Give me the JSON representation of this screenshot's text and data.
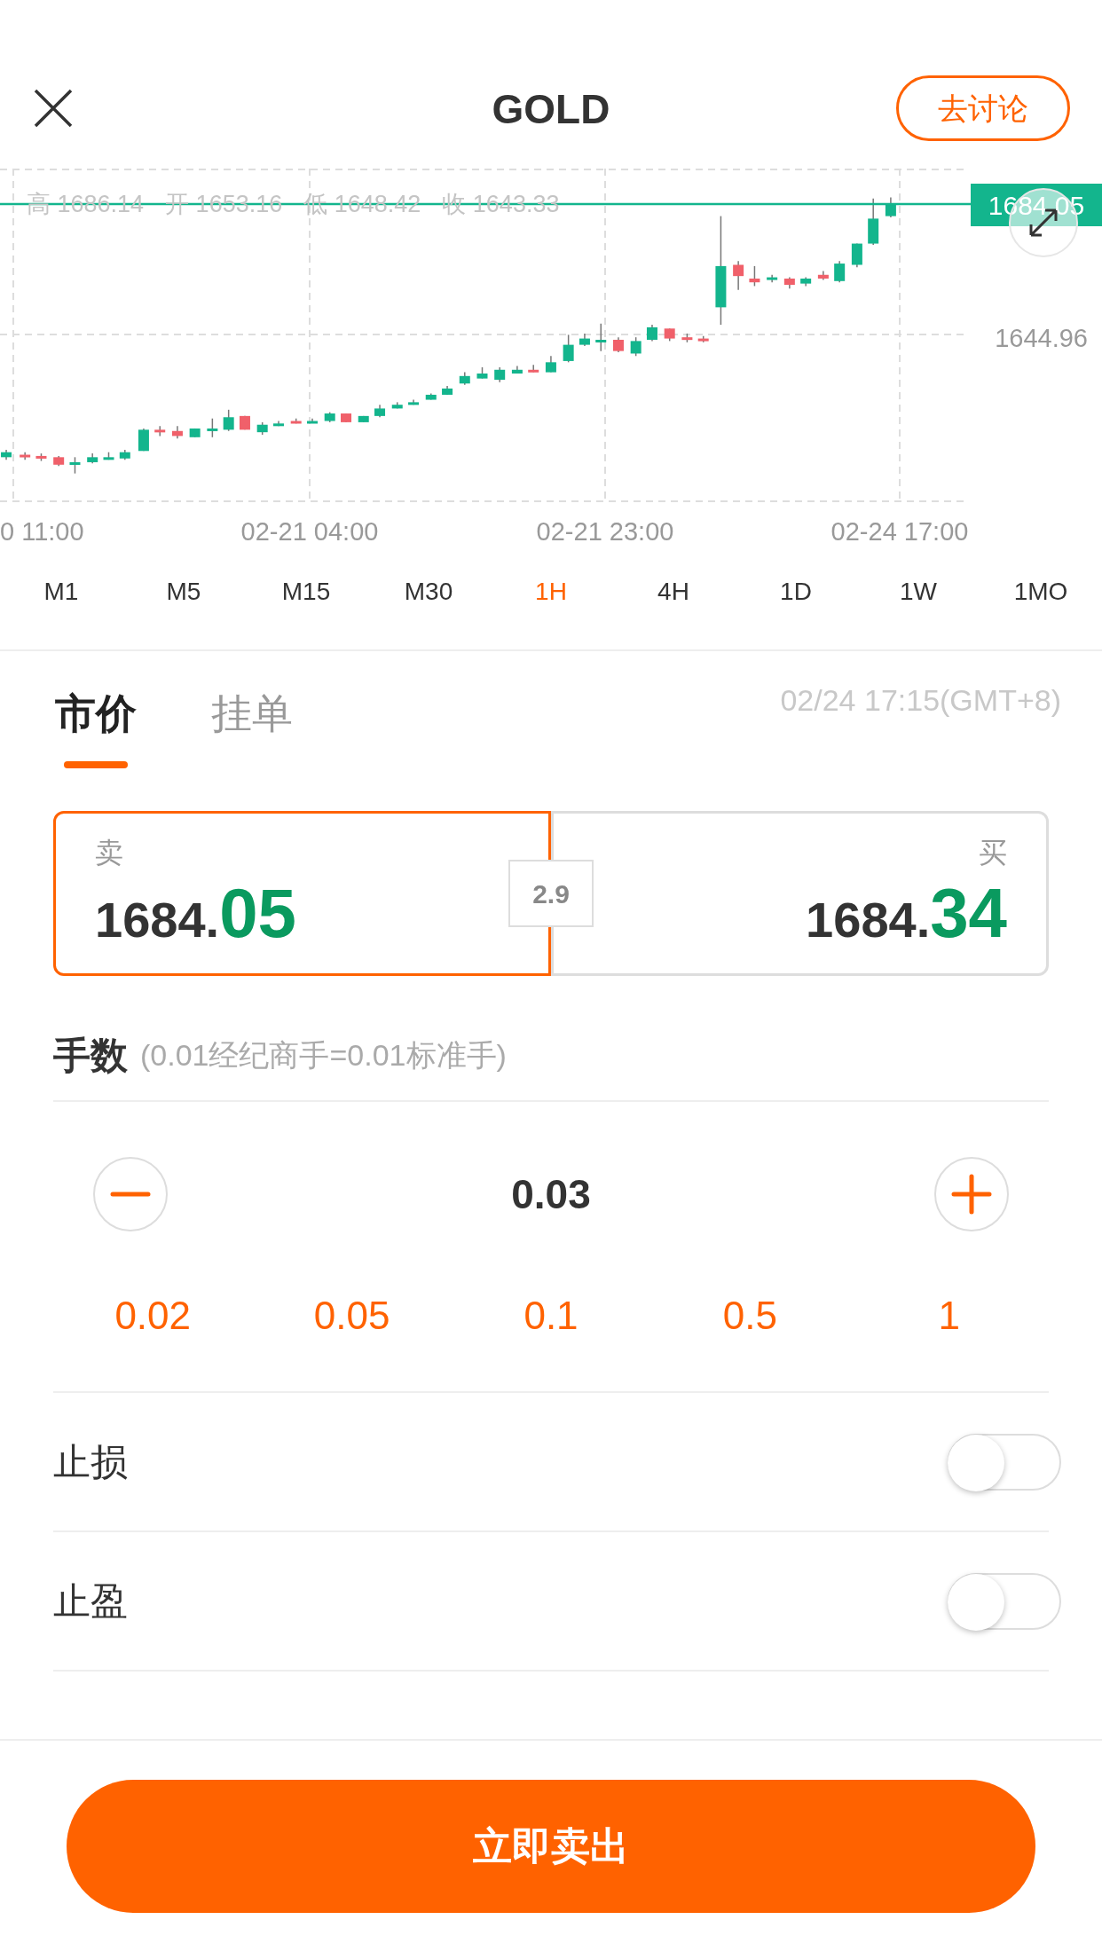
{
  "header": {
    "title": "GOLD",
    "discuss_button": "去讨论"
  },
  "chart": {
    "ohlc": [
      {
        "label": "高",
        "value": "1686.14"
      },
      {
        "label": "开",
        "value": "1653.16"
      },
      {
        "label": "低",
        "value": "1648.42"
      },
      {
        "label": "收",
        "value": "1643.33"
      }
    ],
    "price_tag": "1684.05",
    "y_label": "1644.96",
    "x_labels": [
      "0 11:00",
      "02-21 04:00",
      "02-21 23:00",
      "02-24 17:00"
    ]
  },
  "timeframes": [
    {
      "label": "M1",
      "selected": false
    },
    {
      "label": "M5",
      "selected": false
    },
    {
      "label": "M15",
      "selected": false
    },
    {
      "label": "M30",
      "selected": false
    },
    {
      "label": "1H",
      "selected": true
    },
    {
      "label": "4H",
      "selected": false
    },
    {
      "label": "1D",
      "selected": false
    },
    {
      "label": "1W",
      "selected": false
    },
    {
      "label": "1MO",
      "selected": false
    }
  ],
  "order_tabs": [
    {
      "label": "市价",
      "selected": true
    },
    {
      "label": "挂单",
      "selected": false
    }
  ],
  "timestamp": "02/24 17:15(GMT+8)",
  "quotes": [
    {
      "label": "卖",
      "integer": "1684.",
      "decimals": "05",
      "selected": true
    },
    {
      "label": "买",
      "integer": "1684.",
      "decimals": "34",
      "selected": false
    }
  ],
  "spread": "2.9",
  "lots": {
    "title": "手数",
    "note": "(0.01经纪商手=0.01标准手)",
    "value": "0.03",
    "presets": [
      "0.02",
      "0.05",
      "0.1",
      "0.5",
      "1"
    ]
  },
  "toggles": [
    {
      "label": "止损",
      "on": false
    },
    {
      "label": "止盈",
      "on": false
    }
  ],
  "submit": "立即卖出"
}
